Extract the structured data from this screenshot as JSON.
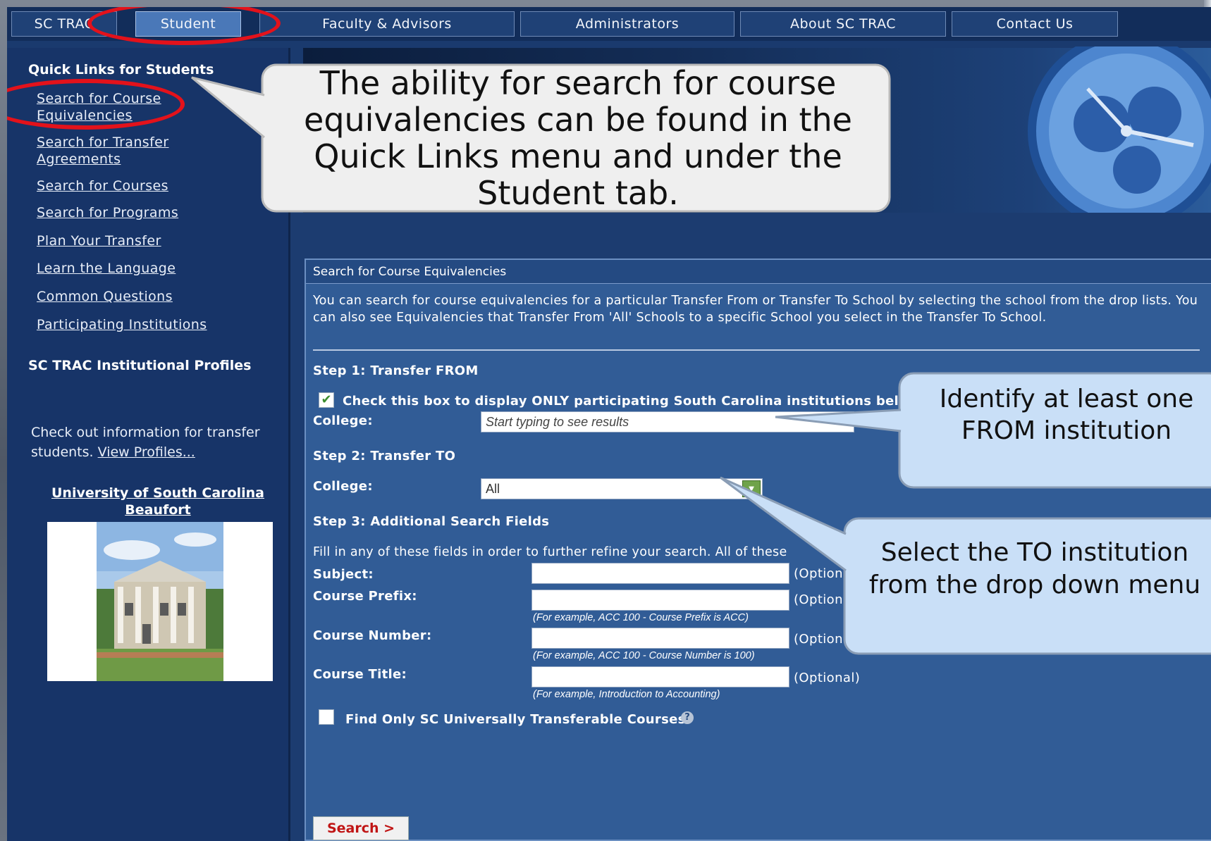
{
  "nav": {
    "tabs": [
      {
        "label": "SC TRAC"
      },
      {
        "label": "Student"
      },
      {
        "label": "Faculty & Advisors"
      },
      {
        "label": "Administrators"
      },
      {
        "label": "About SC TRAC"
      },
      {
        "label": "Contact Us"
      }
    ],
    "active_tab": "Student"
  },
  "sidebar": {
    "quick_links_title": "Quick Links for Students",
    "links": [
      {
        "label": "Search for Course Equivalencies"
      },
      {
        "label": "Search for Transfer Agreements"
      },
      {
        "label": "Search for Courses"
      },
      {
        "label": "Search for Programs"
      },
      {
        "label": "Plan Your Transfer"
      },
      {
        "label": "Learn the Language"
      },
      {
        "label": "Common Questions"
      },
      {
        "label": "Participating Institutions"
      }
    ],
    "profiles_title": "SC TRAC Institutional Profiles",
    "profiles_text": "Check out information for transfer students.",
    "profiles_link": "View Profiles...",
    "institution_name": "University of South Carolina Beaufort"
  },
  "panel": {
    "title": "Search for Course Equivalencies",
    "intro": "You can search for course equivalencies for a particular Transfer From or Transfer To School by selecting the school from the drop lists. You can also see Equivalencies that Transfer From 'All' Schools to a specific School you select in the Transfer To School.",
    "step1": "Step 1: Transfer FROM",
    "checkbox_label": "Check this box to display ONLY participating South Carolina institutions below",
    "checkbox_checked": true,
    "college_label": "College:",
    "college_from_placeholder": "Start typing to see results",
    "step2": "Step 2: Transfer TO",
    "college_to_value": "All",
    "step3": "Step 3: Additional Search Fields",
    "fill_in_text": "Fill in any of these fields in order to further refine your search. All of these",
    "fields": [
      {
        "label": "Subject:",
        "value": "",
        "optional": "(Optional)",
        "example": ""
      },
      {
        "label": "Course Prefix:",
        "value": "",
        "optional": "(Optional)",
        "example": "(For example, ACC 100 - Course Prefix is ACC)"
      },
      {
        "label": "Course Number:",
        "value": "",
        "optional": "(Optional)",
        "example": "(For example, ACC 100 - Course Number is 100)"
      },
      {
        "label": "Course Title:",
        "value": "",
        "optional": "(Optional)",
        "example": "(For example, Introduction to Accounting)"
      }
    ],
    "universal_label": "Find Only SC Universally Transferable Courses",
    "universal_checked": false,
    "help_glyph": "?",
    "search_button": "Search >"
  },
  "callouts": {
    "main": "The ability for search for course equivalencies can be found in the Quick Links menu and under the Student tab.",
    "from": "Identify at least one FROM institution",
    "to": "Select the TO institution from the drop down menu"
  },
  "colors": {
    "highlight_ring": "#e3121b",
    "panel_bg": "#315c96",
    "sidebar_bg": "#173468",
    "callout_blue": "#c9dff7",
    "callout_gray": "#efefef",
    "search_text": "#c01515"
  }
}
